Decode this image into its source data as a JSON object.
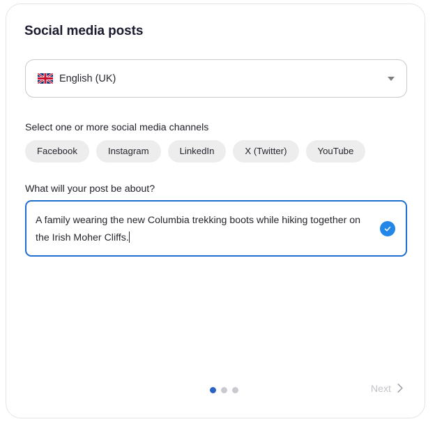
{
  "card": {
    "title": "Social media posts"
  },
  "language_select": {
    "flag_icon": "uk-flag-icon",
    "value": "English (UK)",
    "caret_icon": "chevron-down-icon"
  },
  "channels": {
    "label": "Select one or more social media channels",
    "options": [
      {
        "label": "Facebook"
      },
      {
        "label": "Instagram"
      },
      {
        "label": "LinkedIn"
      },
      {
        "label": "X (Twitter)"
      },
      {
        "label": "YouTube"
      }
    ]
  },
  "prompt": {
    "label": "What will your post be about?",
    "value": "A family wearing the new Columbia trekking boots while hiking together on the Irish Moher Cliffs.",
    "status_icon": "check-circle-icon",
    "status_color": "#2287e8"
  },
  "footer": {
    "dots": [
      {
        "state": "active"
      },
      {
        "state": "inactive"
      },
      {
        "state": "inactive"
      }
    ],
    "next_label": "Next",
    "next_icon": "chevron-right-icon"
  }
}
